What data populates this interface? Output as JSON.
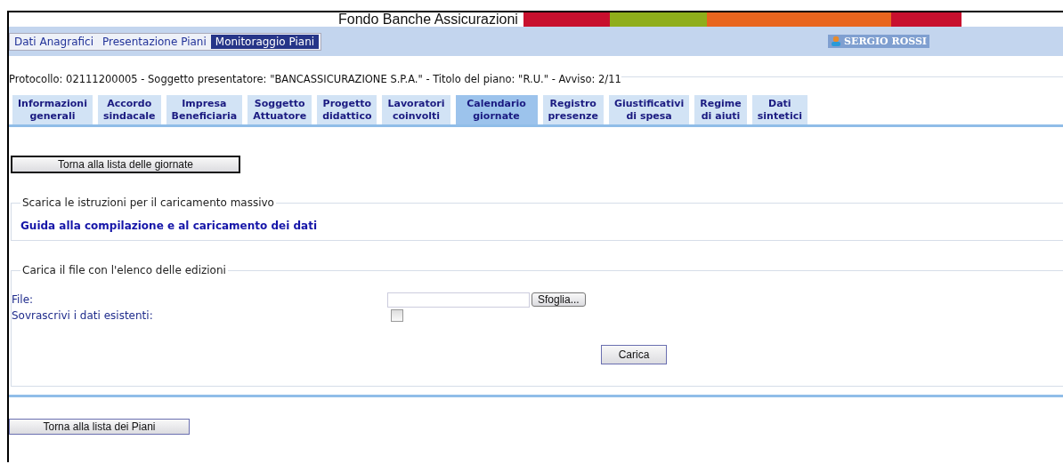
{
  "header": {
    "title": "Fondo Banche Assicurazioni",
    "stripes": [
      {
        "color": "#c8102e"
      },
      {
        "color": "#8fae1b"
      },
      {
        "color": "#e8651e"
      },
      {
        "color": "#c8102e"
      }
    ]
  },
  "menu": [
    {
      "label": "Dati Anagrafici",
      "selected": false
    },
    {
      "label": "Presentazione Piani",
      "selected": false
    },
    {
      "label": "Monitoraggio Piani",
      "selected": true
    }
  ],
  "user": "SERGIO ROSSI",
  "protocol": "Protocollo: 02111200005 - Soggetto presentatore: \"BANCASSICURAZIONE S.P.A.\" - Titolo del piano: \"R.U.\" - Avviso: 2/11",
  "tabs": [
    {
      "label": "Informazioni generali",
      "selected": false
    },
    {
      "label": "Accordo sindacale",
      "selected": false
    },
    {
      "label": "Impresa Beneficiaria",
      "selected": false
    },
    {
      "label": "Soggetto Attuatore",
      "selected": false
    },
    {
      "label": "Progetto didattico",
      "selected": false
    },
    {
      "label": "Lavoratori coinvolti",
      "selected": false
    },
    {
      "label": "Calendario giornate",
      "selected": true
    },
    {
      "label": "Registro presenze",
      "selected": false
    },
    {
      "label": "Giustificativi di spesa",
      "selected": false
    },
    {
      "label": "Regime di aiuti",
      "selected": false
    },
    {
      "label": "Dati sintetici",
      "selected": false
    }
  ],
  "back_button": "Torna alla lista delle giornate",
  "download_section": {
    "legend": "Scarica le istruzioni per il caricamento massivo",
    "link": "Guida alla compilazione e al caricamento dei dati"
  },
  "upload_section": {
    "legend": "Carica il file con l'elenco delle edizioni",
    "file_label": "File:",
    "browse_button": "Sfoglia...",
    "overwrite_label": "Sovrascrivi i dati esistenti:",
    "overwrite_checked": false,
    "submit_button": "Carica"
  },
  "bottom_button": "Torna alla lista dei Piani"
}
